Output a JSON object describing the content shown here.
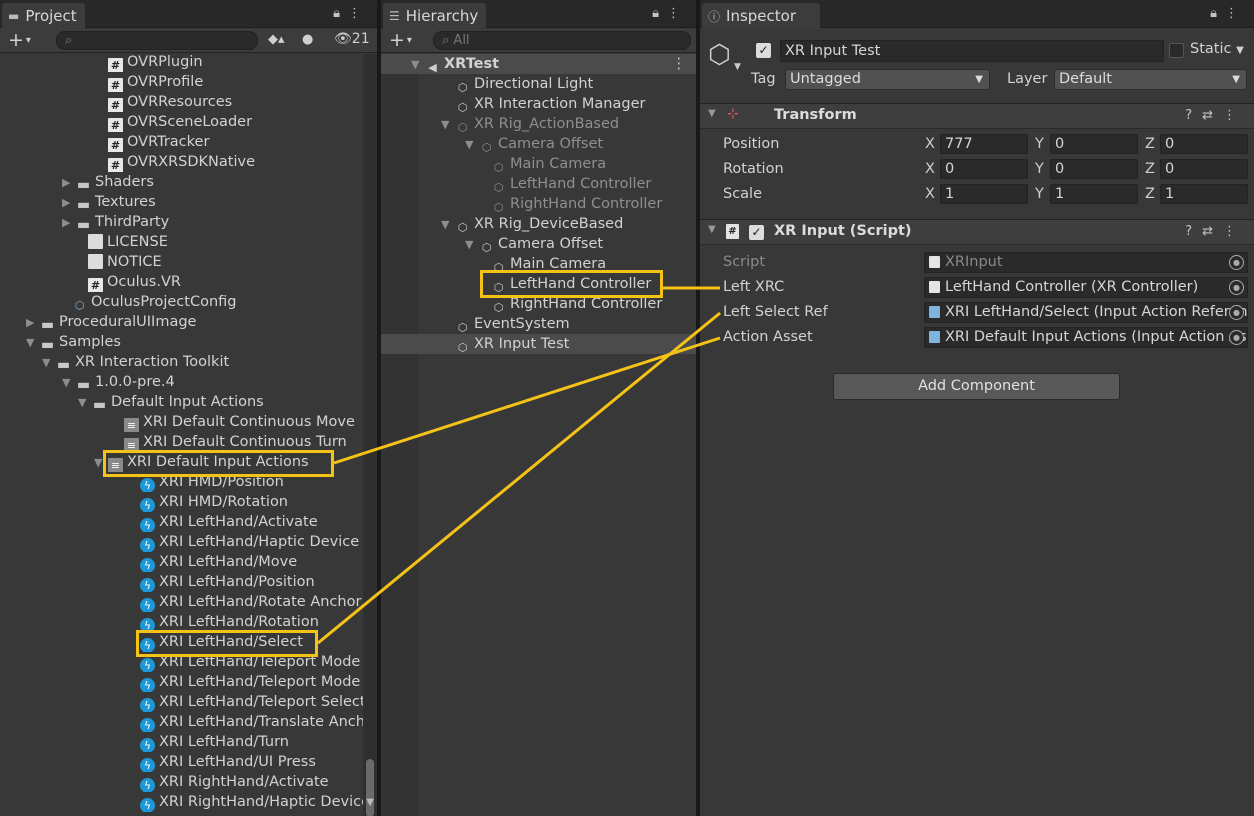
{
  "project": {
    "tab": "Project",
    "hidden_count": "21",
    "items": [
      {
        "label": "OVRPlugin",
        "icon": "script-icon"
      },
      {
        "label": "OVRProfile",
        "icon": "script-icon"
      },
      {
        "label": "OVRResources",
        "icon": "script-icon"
      },
      {
        "label": "OVRSceneLoader",
        "icon": "script-icon"
      },
      {
        "label": "OVRTracker",
        "icon": "script-icon"
      },
      {
        "label": "OVRXRSDKNative",
        "icon": "script-icon"
      },
      {
        "label": "Shaders",
        "icon": "folder-icon"
      },
      {
        "label": "Textures",
        "icon": "folder-icon"
      },
      {
        "label": "ThirdParty",
        "icon": "folder-icon"
      },
      {
        "label": "LICENSE",
        "icon": "document-icon"
      },
      {
        "label": "NOTICE",
        "icon": "document-icon"
      },
      {
        "label": "Oculus.VR",
        "icon": "assembly-icon"
      },
      {
        "label": "OculusProjectConfig",
        "icon": "config-icon"
      },
      {
        "label": "ProceduralUIImage",
        "icon": "folder-icon"
      },
      {
        "label": "Samples",
        "icon": "folder-open-icon"
      },
      {
        "label": "XR Interaction Toolkit",
        "icon": "folder-open-icon"
      },
      {
        "label": "1.0.0-pre.4",
        "icon": "folder-open-icon"
      },
      {
        "label": "Default Input Actions",
        "icon": "folder-open-icon"
      },
      {
        "label": "XRI Default Continuous Move",
        "icon": "preset-icon"
      },
      {
        "label": "XRI Default Continuous Turn",
        "icon": "preset-icon"
      },
      {
        "label": "XRI Default Input Actions",
        "icon": "input-actions-icon"
      },
      {
        "label": "XRI HMD/Position",
        "icon": "input-action-icon"
      },
      {
        "label": "XRI HMD/Rotation",
        "icon": "input-action-icon"
      },
      {
        "label": "XRI LeftHand/Activate",
        "icon": "input-action-icon"
      },
      {
        "label": "XRI LeftHand/Haptic Device",
        "icon": "input-action-icon"
      },
      {
        "label": "XRI LeftHand/Move",
        "icon": "input-action-icon"
      },
      {
        "label": "XRI LeftHand/Position",
        "icon": "input-action-icon"
      },
      {
        "label": "XRI LeftHand/Rotate Anchor",
        "icon": "input-action-icon"
      },
      {
        "label": "XRI LeftHand/Rotation",
        "icon": "input-action-icon"
      },
      {
        "label": "XRI LeftHand/Select",
        "icon": "input-action-icon"
      },
      {
        "label": "XRI LeftHand/Teleport Mode",
        "icon": "input-action-icon"
      },
      {
        "label": "XRI LeftHand/Teleport Mode",
        "icon": "input-action-icon"
      },
      {
        "label": "XRI LeftHand/Teleport Select",
        "icon": "input-action-icon"
      },
      {
        "label": "XRI LeftHand/Translate Anchor",
        "icon": "input-action-icon"
      },
      {
        "label": "XRI LeftHand/Turn",
        "icon": "input-action-icon"
      },
      {
        "label": "XRI LeftHand/UI Press",
        "icon": "input-action-icon"
      },
      {
        "label": "XRI RightHand/Activate",
        "icon": "input-action-icon"
      },
      {
        "label": "XRI RightHand/Haptic Device",
        "icon": "input-action-icon"
      }
    ]
  },
  "hierarchy": {
    "tab": "Hierarchy",
    "search_placeholder": "All",
    "items": [
      {
        "label": "XRTest",
        "icon": "unity-scene-icon"
      },
      {
        "label": "Directional Light",
        "icon": "gameobject-icon"
      },
      {
        "label": "XR Interaction Manager",
        "icon": "gameobject-icon"
      },
      {
        "label": "XR Rig_ActionBased",
        "icon": "gameobject-icon"
      },
      {
        "label": "Camera Offset",
        "icon": "gameobject-icon"
      },
      {
        "label": "Main Camera",
        "icon": "gameobject-icon"
      },
      {
        "label": "LeftHand Controller",
        "icon": "gameobject-icon"
      },
      {
        "label": "RightHand Controller",
        "icon": "gameobject-icon"
      },
      {
        "label": "XR Rig_DeviceBased",
        "icon": "gameobject-icon"
      },
      {
        "label": "Camera Offset",
        "icon": "gameobject-icon"
      },
      {
        "label": "Main Camera",
        "icon": "gameobject-icon"
      },
      {
        "label": "LeftHand Controller",
        "icon": "gameobject-icon"
      },
      {
        "label": "RightHand Controller",
        "icon": "gameobject-icon"
      },
      {
        "label": "EventSystem",
        "icon": "gameobject-icon"
      },
      {
        "label": "XR Input Test",
        "icon": "gameobject-icon"
      }
    ]
  },
  "inspector": {
    "tab": "Inspector",
    "object_name": "XR Input Test",
    "static_label": "Static",
    "tag_label": "Tag",
    "tag_value": "Untagged",
    "layer_label": "Layer",
    "layer_value": "Default",
    "transform": {
      "title": "Transform",
      "position_label": "Position",
      "rotation_label": "Rotation",
      "scale_label": "Scale",
      "x": "X",
      "y": "Y",
      "z": "Z",
      "position": [
        "777",
        "0",
        "0"
      ],
      "rotation": [
        "0",
        "0",
        "0"
      ],
      "scale": [
        "1",
        "1",
        "1"
      ]
    },
    "script_comp": {
      "title": "XR Input (Script)",
      "script_label": "Script",
      "script_value": "XRInput",
      "left_xrc_label": "Left XRC",
      "left_xrc_value": "LeftHand Controller (XR Controller)",
      "left_select_label": "Left Select Ref",
      "left_select_value": "XRI LeftHand/Select (Input Action Reference)",
      "action_asset_label": "Action Asset",
      "action_asset_value": "XRI Default Input Actions (Input Action Asset)"
    },
    "add_component": "Add Component"
  },
  "annotation_color": "#f5c318"
}
